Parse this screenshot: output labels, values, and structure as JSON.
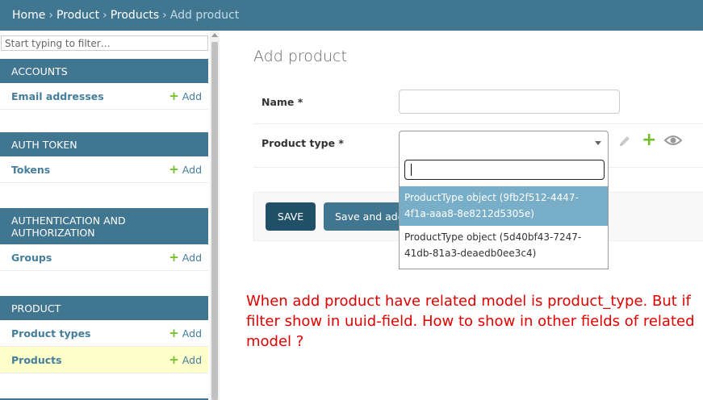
{
  "breadcrumbs": {
    "home": "Home",
    "app": "Product",
    "model": "Products",
    "current": "Add product",
    "separator": "›"
  },
  "sidebar": {
    "filter_placeholder": "Start typing to filter…",
    "modules": [
      {
        "caption": "ACCOUNTS",
        "models": [
          {
            "name": "Email addresses",
            "add": "Add"
          }
        ]
      },
      {
        "caption": "AUTH TOKEN",
        "models": [
          {
            "name": "Tokens",
            "add": "Add"
          }
        ]
      },
      {
        "caption": "AUTHENTICATION AND AUTHORIZATION",
        "models": [
          {
            "name": "Groups",
            "add": "Add"
          }
        ]
      },
      {
        "caption": "PRODUCT",
        "models": [
          {
            "name": "Product types",
            "add": "Add"
          },
          {
            "name": "Products",
            "add": "Add",
            "selected": true
          }
        ]
      }
    ]
  },
  "main": {
    "title": "Add product",
    "fields": {
      "name_label": "Name *",
      "name_value": "",
      "product_type_label": "Product type *",
      "product_type_value": ""
    },
    "dropdown": {
      "search_value": "",
      "options": [
        "ProductType object (9fb2f512-4447-4f1a-aaa8-8e8212d5305e)",
        "ProductType object (5d40bf43-7247-41db-81a3-deaedb0ee3c4)"
      ],
      "highlighted_index": 0
    },
    "buttons": {
      "save": "SAVE",
      "save_add_another": "Save and add another"
    }
  },
  "annotation": "When add product have related model is product_type. But if filter show in uuid-field. How to show in other fields of related model ?",
  "colors": {
    "header_blue": "#417690",
    "link_blue": "#447e9b",
    "save_button": "#205067",
    "add_green": "#70bf2b",
    "highlight": "#79aec8",
    "selected_row": "#ffffcc",
    "annotation_red": "#e00000"
  },
  "icons": {
    "change_related": "pencil-icon",
    "add_related": "plus-icon",
    "view_related": "eye-icon"
  }
}
